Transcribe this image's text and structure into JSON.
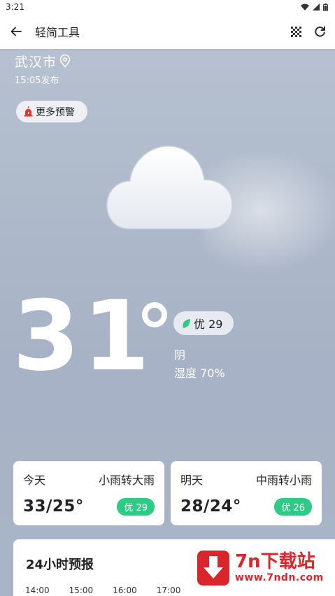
{
  "status_bar": {
    "time": "3:21"
  },
  "app_bar": {
    "title": "轻简工具"
  },
  "location": {
    "city": "武汉市",
    "publish_time": "15:05发布"
  },
  "alert": {
    "label": "更多预警"
  },
  "current": {
    "temperature": "31",
    "aqi_label": "优 29",
    "condition": "阴",
    "humidity": "湿度 70%"
  },
  "today": {
    "label": "今天",
    "condition": "小雨转大雨",
    "range": "33/25°",
    "aqi": "优 29"
  },
  "tomorrow": {
    "label": "明天",
    "condition": "中雨转小雨",
    "range": "28/24°",
    "aqi": "优 26"
  },
  "hourly": {
    "title": "24小时预报",
    "hours": [
      "14:00",
      "15:00",
      "16:00",
      "17:00"
    ]
  },
  "watermark": {
    "main": "7n下载站",
    "sub": "www.7ndn.com"
  },
  "colors": {
    "aqi_good": "#2fcb86",
    "watermark_red": "#d9262c"
  }
}
